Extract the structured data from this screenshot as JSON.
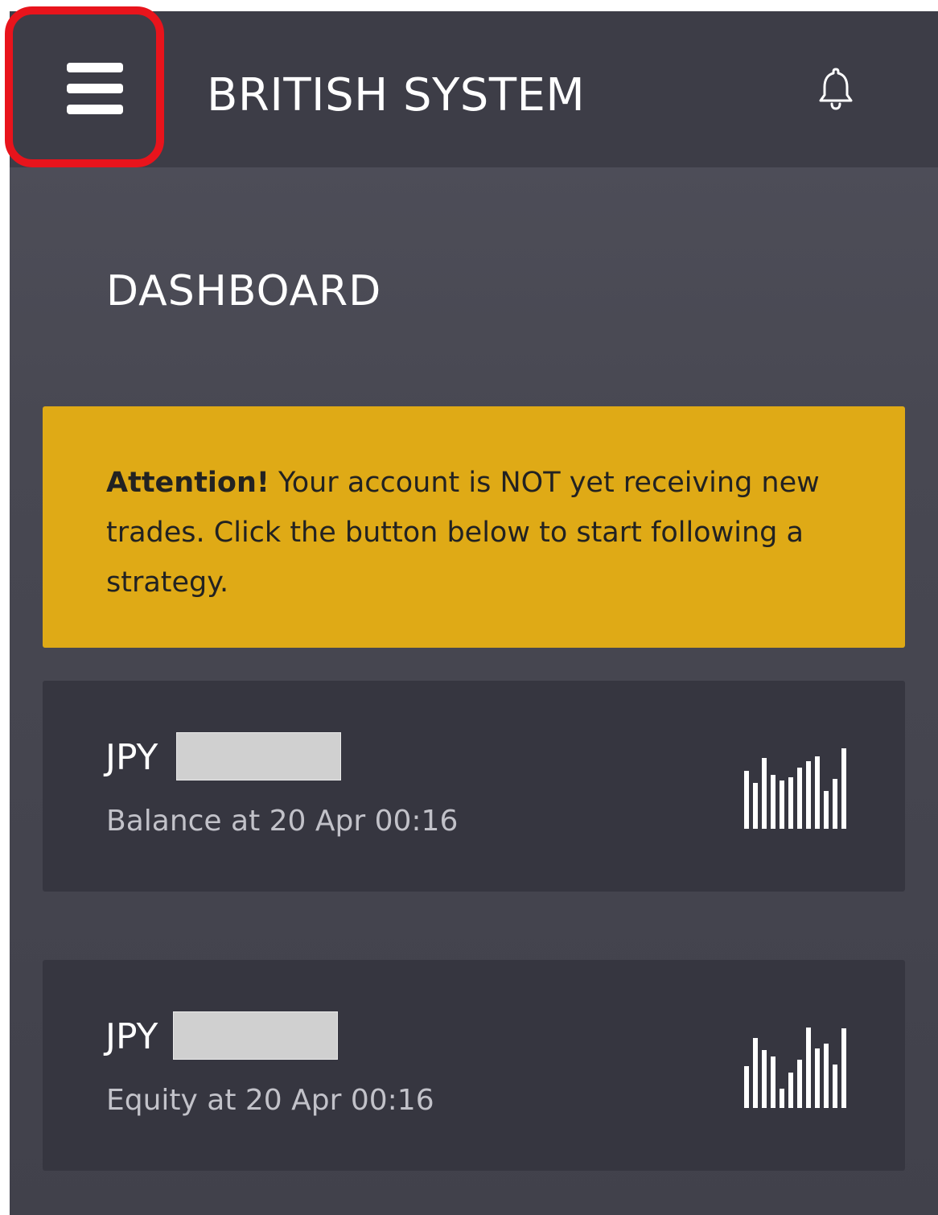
{
  "header": {
    "menu_icon": "hamburger-menu-icon",
    "title": "BRITISH SYSTEM",
    "notification_icon": "bell-icon",
    "highlight_color": "#e8141c"
  },
  "page": {
    "title": "DASHBOARD"
  },
  "alert": {
    "strong": "Attention!",
    "message": " Your account is NOT yet receiving new trades. Click the button below to start following a strategy.",
    "background": "#dfaa16"
  },
  "cards": [
    {
      "currency": "JPY",
      "value_hidden": true,
      "subtitle": "Balance at 20 Apr 00:16",
      "icon": "bar-chart-icon"
    },
    {
      "currency": "JPY",
      "value_hidden": true,
      "subtitle": "Equity at 20 Apr 00:16",
      "icon": "bar-chart-icon"
    }
  ],
  "colors": {
    "topbar": "#3d3d47",
    "card": "#363640",
    "text": "#ffffff"
  }
}
